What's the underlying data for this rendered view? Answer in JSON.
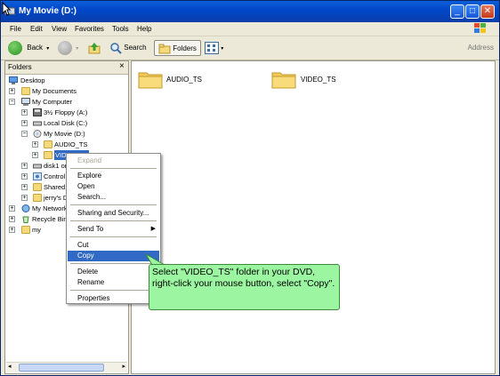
{
  "window": {
    "title": "My Movie (D:)"
  },
  "menubar": [
    "File",
    "Edit",
    "View",
    "Favorites",
    "Tools",
    "Help"
  ],
  "toolbar": {
    "back": "Back",
    "search": "Search",
    "folders": "Folders"
  },
  "address_label": "Address",
  "folders_pane": {
    "title": "Folders",
    "tree": [
      {
        "label": "Desktop",
        "icon": "desktop-icon"
      },
      {
        "label": "My Documents",
        "icon": "folder-icon"
      },
      {
        "label": "My Computer",
        "icon": "computer-icon"
      },
      {
        "label": "3½ Floppy (A:)",
        "icon": "floppy-icon"
      },
      {
        "label": "Local Disk (C:)",
        "icon": "hard-disk-icon"
      },
      {
        "label": "My Movie (D:)",
        "icon": "dvd-drive-icon"
      },
      {
        "label": "AUDIO_TS",
        "icon": "folder-icon"
      },
      {
        "label": "VIDEO_TS",
        "icon": "folder-icon"
      },
      {
        "label": "disk1 or",
        "icon": "hard-disk-icon"
      },
      {
        "label": "Control",
        "icon": "control-panel-icon"
      },
      {
        "label": "Shared",
        "icon": "folder-icon"
      },
      {
        "label": "jerry's D",
        "icon": "folder-icon"
      },
      {
        "label": "My Network",
        "icon": "network-icon"
      },
      {
        "label": "Recycle Bin",
        "icon": "recycle-bin-icon"
      },
      {
        "label": "my",
        "icon": "folder-icon"
      }
    ]
  },
  "content": {
    "items": [
      {
        "label": "AUDIO_TS"
      },
      {
        "label": "VIDEO_TS"
      }
    ]
  },
  "context_menu": {
    "items": [
      {
        "label": "Expand"
      },
      {
        "label": "Explore"
      },
      {
        "label": "Open"
      },
      {
        "label": "Search..."
      },
      {
        "label": "Sharing and Security..."
      },
      {
        "label": "Send To"
      },
      {
        "label": "Cut"
      },
      {
        "label": "Copy"
      },
      {
        "label": "Delete"
      },
      {
        "label": "Rename"
      },
      {
        "label": "Properties"
      }
    ]
  },
  "callout": {
    "text": "Select \"VIDEO_TS\" folder in your DVD, right-click your mouse button, select \"Copy\"."
  },
  "colors": {
    "titlebar": "#0047C9",
    "highlight": "#316AC5",
    "callout": "#9BF5A1"
  }
}
